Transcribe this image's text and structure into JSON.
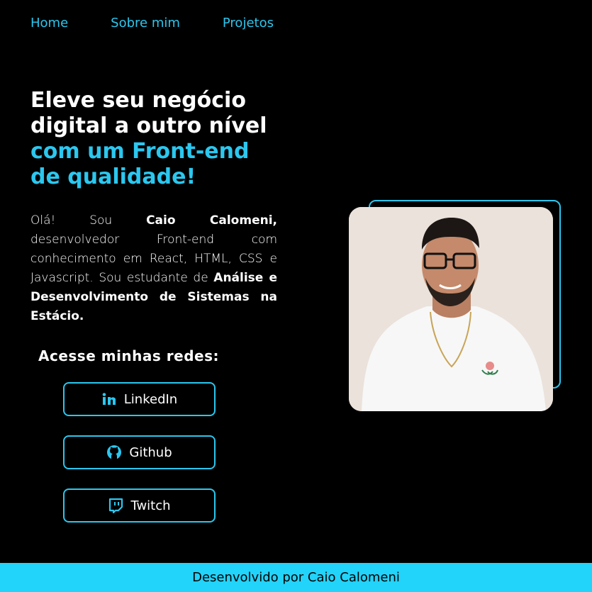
{
  "nav": {
    "items": [
      {
        "label": "Home"
      },
      {
        "label": "Sobre mim"
      },
      {
        "label": "Projetos"
      }
    ]
  },
  "hero": {
    "title_line1": "Eleve seu negócio",
    "title_line2": "digital a outro nível",
    "title_accent_line1": "com um Front-end",
    "title_accent_line2": "de qualidade!"
  },
  "intro": {
    "part1": "Olá! Sou ",
    "name": "Caio Calomeni,",
    "part2": " desenvolvedor Front-end com conhecimento em React, HTML, CSS e Javascript. Sou estudante de ",
    "course": "Análise e Desenvolvimento de Sistemas na Estácio."
  },
  "social": {
    "heading": "Acesse minhas redes:",
    "buttons": [
      {
        "label": "LinkedIn",
        "icon": "linkedin-icon"
      },
      {
        "label": "Github",
        "icon": "github-icon"
      },
      {
        "label": "Twitch",
        "icon": "twitch-icon"
      }
    ]
  },
  "footer": {
    "text": "Desenvolvido por Caio Calomeni"
  },
  "colors": {
    "accent": "#2bc7ef",
    "footer_bg": "#22d3fa",
    "background": "#000000"
  }
}
